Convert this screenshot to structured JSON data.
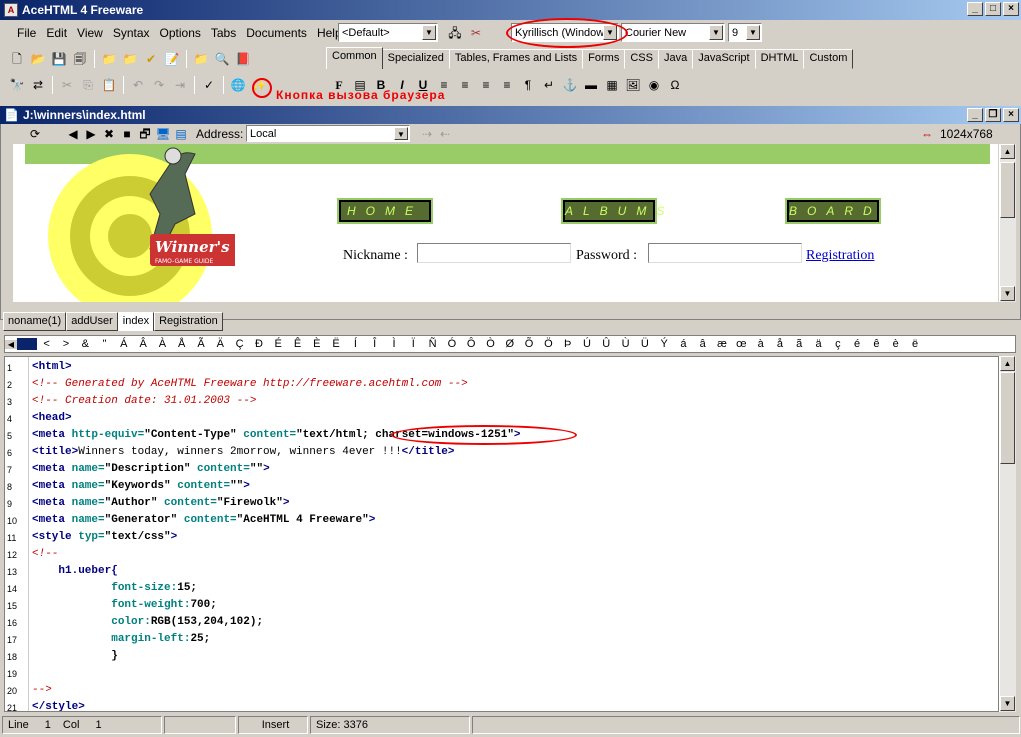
{
  "window": {
    "title": "AceHTML 4 Freeware"
  },
  "menu": {
    "file": "File",
    "edit": "Edit",
    "view": "View",
    "syntax": "Syntax",
    "options": "Options",
    "tabs": "Tabs",
    "documents": "Documents",
    "help": "Help"
  },
  "toolbar": {
    "style_combo": "<Default>",
    "charset_combo": "Kyrillisch (Windows",
    "font_combo": "Courier New",
    "size_combo": "9"
  },
  "tool_tabs": [
    "Common",
    "Specialized",
    "Tables, Frames and Lists",
    "Forms",
    "CSS",
    "Java",
    "JavaScript",
    "DHTML",
    "Custom"
  ],
  "annotation": {
    "browser_button": "Кнопка вызова браузера"
  },
  "editor": {
    "title": "J:\\winners\\index.html",
    "address_label": "Address:",
    "address_value": "Local",
    "resolution": "1024x768"
  },
  "preview": {
    "nav_home": "HOME",
    "nav_albums": "ALBUMS",
    "nav_board": "BOARD",
    "nickname_label": "Nickname :",
    "password_label": "Password :",
    "registration_link": "Registration",
    "logo_text": "Winner's",
    "logo_sub": "FAMO-GAME GUIDE"
  },
  "doc_tabs": [
    "noname(1)",
    "addUser",
    "index",
    "Registration"
  ],
  "chars": [
    "<",
    ">",
    "&",
    "\"",
    "Á",
    "Â",
    "À",
    "Å",
    "Ã",
    "Ä",
    "Ç",
    "Ð",
    "É",
    "Ê",
    "È",
    "Ë",
    "Í",
    "Î",
    "Ì",
    "Ï",
    "Ñ",
    "Ó",
    "Ô",
    "Ò",
    "Ø",
    "Õ",
    "Ö",
    "Þ",
    "Ú",
    "Û",
    "Ù",
    "Ü",
    "Ý",
    "á",
    "â",
    "æ",
    "œ",
    "à",
    "å",
    "ã",
    "ä",
    "ç",
    "é",
    "ê",
    "è",
    "ë"
  ],
  "code": {
    "l1": "<html>",
    "l2": "<!-- Generated by AceHTML Freeware http://freeware.acehtml.com -->",
    "l3": "<!-- Creation date: 31.01.2003 -->",
    "l4": "<head>",
    "l5a": "<meta ",
    "l5b": "http-equiv=",
    "l5c": "\"Content-Type\" ",
    "l5d": "content=",
    "l5e": "\"text/html; charset=windows-1251\"",
    "l5f": ">",
    "l6a": "<title>",
    "l6b": "Winners today, winners 2morrow, winners 4ever !!!",
    "l6c": "</title>",
    "l7a": "<meta ",
    "l7b": "name=",
    "l7c": "\"Description\" ",
    "l7d": "content=",
    "l7e": "\"\"",
    "l7f": ">",
    "l8a": "<meta ",
    "l8b": "name=",
    "l8c": "\"Keywords\" ",
    "l8d": "content=",
    "l8e": "\"\"",
    "l8f": ">",
    "l9a": "<meta ",
    "l9b": "name=",
    "l9c": "\"Author\" ",
    "l9d": "content=",
    "l9e": "\"Firewolk\"",
    "l9f": ">",
    "l10a": "<meta ",
    "l10b": "name=",
    "l10c": "\"Generator\" ",
    "l10d": "content=",
    "l10e": "\"AceHTML 4 Freeware\"",
    "l10f": ">",
    "l11a": "<style ",
    "l11b": "typ=",
    "l11c": "\"text/css\"",
    "l11d": ">",
    "l12": "<!--",
    "l13": "    h1.ueber{",
    "l14a": "            font-size:",
    "l14b": "15;",
    "l15a": "            font-weight:",
    "l15b": "700;",
    "l16a": "            color:",
    "l16b": "RGB(153,204,102);",
    "l17a": "            margin-left:",
    "l17b": "25;",
    "l18": "            }",
    "l19": "",
    "l20": "-->",
    "l21": "</style>"
  },
  "line_numbers": [
    "1",
    "2",
    "3",
    "4",
    "5",
    "6",
    "7",
    "8",
    "9",
    "10",
    "11",
    "12",
    "13",
    "14",
    "15",
    "16",
    "17",
    "18",
    "19",
    "20",
    "21"
  ],
  "status": {
    "line_label": "Line",
    "line_value": "1",
    "col_label": "Col",
    "col_value": "1",
    "mode": "Insert",
    "size": "Size: 3376"
  }
}
